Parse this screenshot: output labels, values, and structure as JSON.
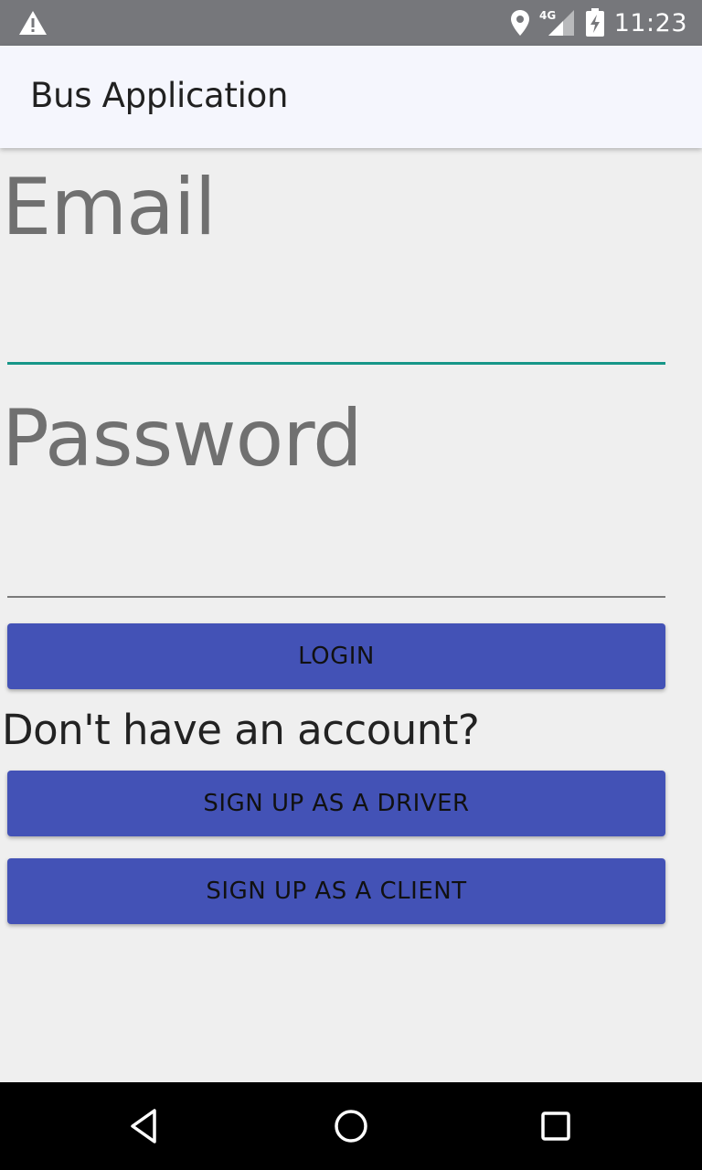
{
  "status_bar": {
    "time": "11:23",
    "network": "4G",
    "icons": [
      "warning-icon",
      "location-icon",
      "signal-icon",
      "battery-charging-icon"
    ]
  },
  "app_bar": {
    "title": "Bus Application"
  },
  "form": {
    "email_label": "Email",
    "email_value": "",
    "password_label": "Password",
    "password_value": "",
    "login_label": "LOGIN",
    "prompt": "Don't have an account?",
    "signup_driver_label": "SIGN UP AS A DRIVER",
    "signup_client_label": "SIGN UP AS A CLIENT"
  },
  "nav_bar": {
    "icons": [
      "back-icon",
      "home-icon",
      "recents-icon"
    ]
  },
  "colors": {
    "accent": "#179688",
    "button": "#4352b6",
    "status_bar": "#76777b",
    "app_bar": "#f5f6fd",
    "background": "#efefef"
  }
}
